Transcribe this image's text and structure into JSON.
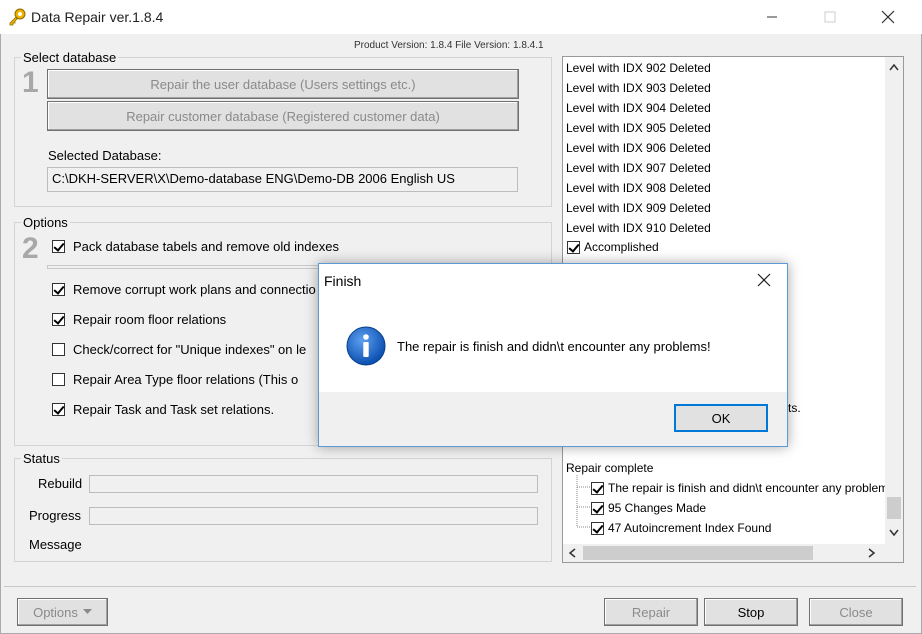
{
  "window": {
    "title": "Data Repair ver.1.8.4"
  },
  "version": {
    "text": "Product Version: 1.8.4    File Version: 1.8.4.1"
  },
  "select_db": {
    "legend": "Select database",
    "step": "1",
    "btn_user": "Repair the user database  (Users settings etc.)",
    "btn_customer": "Repair customer database  (Registered customer data)",
    "selected_label": "Selected Database:",
    "selected_value": "C:\\DKH-SERVER\\X\\Demo-database ENG\\Demo-DB 2006 English US"
  },
  "options": {
    "legend": "Options",
    "step": "2",
    "items": [
      {
        "label": "Pack database tabels and remove old indexes",
        "checked": true
      },
      {
        "label": "Remove corrupt work plans and connectio",
        "checked": true
      },
      {
        "label": "Repair room floor relations",
        "checked": true
      },
      {
        "label": "Check/correct for \"Unique indexes\" on le",
        "checked": false
      },
      {
        "label": "Repair Area Type floor relations    (This o",
        "checked": false
      },
      {
        "label": "Repair Task and Task set relations.",
        "checked": true
      }
    ]
  },
  "status": {
    "legend": "Status",
    "rebuild": "Rebuild",
    "progress": "Progress",
    "message": "Message"
  },
  "log": {
    "lines": [
      "Level with IDX 902 Deleted",
      "Level with IDX 903 Deleted",
      "Level with IDX 904 Deleted",
      "Level with IDX 905 Deleted",
      "Level with IDX 906 Deleted",
      "Level with IDX 907 Deleted",
      "Level with IDX 908 Deleted",
      "Level with IDX 909 Deleted",
      "Level with IDX 910 Deleted"
    ],
    "accomplished": "Accomplished",
    "partial": "ts.",
    "repair_complete": "Repair complete",
    "tree": [
      "The repair is finish and didn\\t encounter any problems",
      "95 Changes Made",
      "47 Autoincrement Index Found"
    ]
  },
  "dialog": {
    "title": "Finish",
    "message": "The repair is finish and didn\\t encounter any problems!",
    "ok": "OK"
  },
  "footer": {
    "options": "Options",
    "repair": "Repair",
    "stop": "Stop",
    "close": "Close"
  }
}
